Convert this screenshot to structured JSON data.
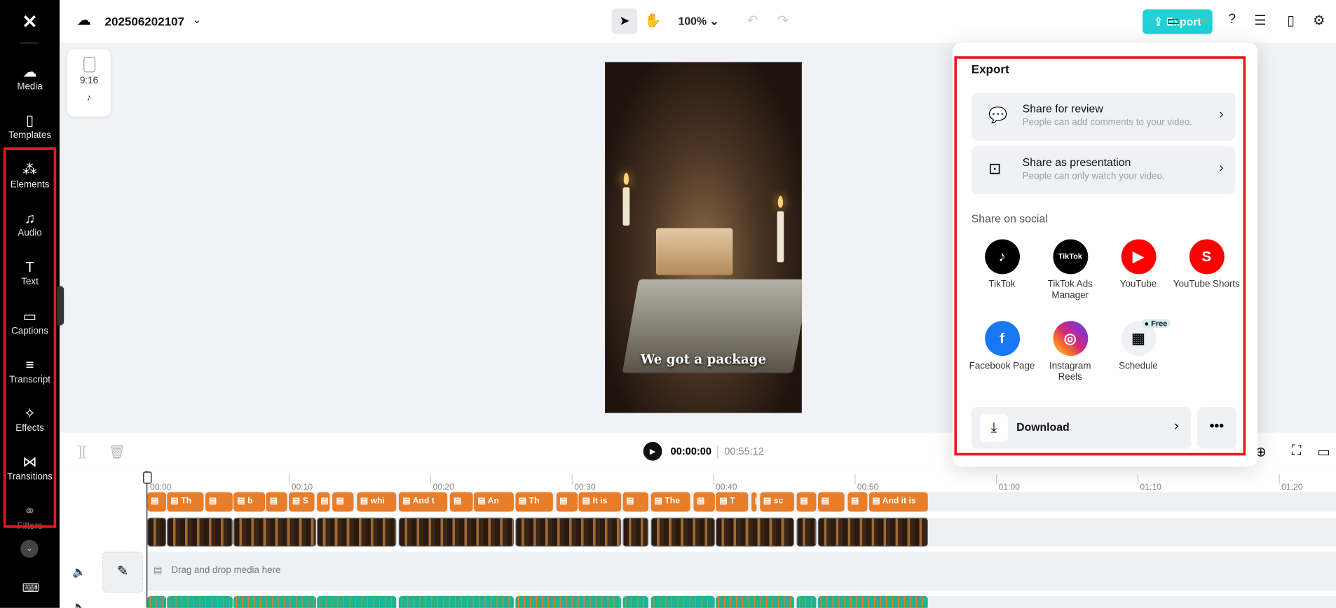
{
  "header": {
    "project_name": "202506202107",
    "zoom": "100%",
    "export_label": "Export"
  },
  "sidebar": {
    "items": [
      {
        "label": "Media",
        "icon": "☁"
      },
      {
        "label": "Templates",
        "icon": "▯"
      },
      {
        "label": "Elements",
        "icon": "⁂"
      },
      {
        "label": "Audio",
        "icon": "♫"
      },
      {
        "label": "Text",
        "icon": "T"
      },
      {
        "label": "Captions",
        "icon": "▭"
      },
      {
        "label": "Transcript",
        "icon": "≡"
      },
      {
        "label": "Effects",
        "icon": "✧"
      },
      {
        "label": "Transitions",
        "icon": "⋈"
      },
      {
        "label": "Filters",
        "icon": "⚭"
      }
    ]
  },
  "canvas": {
    "ratio": "9:16",
    "caption": "We got a package"
  },
  "export_panel": {
    "title": "Export",
    "share_review": {
      "title": "Share for review",
      "subtitle": "People can add comments to your video."
    },
    "share_presentation": {
      "title": "Share as presentation",
      "subtitle": "People can only watch your video."
    },
    "social_heading": "Share on social",
    "socials": [
      {
        "label": "TikTok",
        "color": "#000000",
        "glyph": "♪"
      },
      {
        "label": "TikTok Ads Manager",
        "color": "#000000",
        "glyph": "TikTok"
      },
      {
        "label": "YouTube",
        "color": "#ff0000",
        "glyph": "▶"
      },
      {
        "label": "YouTube Shorts",
        "color": "#ff0000",
        "glyph": "S"
      },
      {
        "label": "Facebook Page",
        "color": "#1877f2",
        "glyph": "f"
      },
      {
        "label": "Instagram Reels",
        "color": "#d62976",
        "glyph": "◎"
      },
      {
        "label": "Schedule",
        "color": "#eff1f4",
        "glyph": "▦"
      }
    ],
    "free_badge": "Free",
    "download_label": "Download"
  },
  "playback": {
    "current": "00:00:00",
    "total": "00:55:12"
  },
  "timeline": {
    "ruler": [
      "00:00",
      "00:10",
      "00:20",
      "00:30",
      "00:40",
      "00:50",
      "01:00",
      "01:10",
      "01:20"
    ],
    "drop_hint": "Drag and drop media here",
    "caption_clips": [
      {
        "s": 0,
        "e": 1.3,
        "t": ""
      },
      {
        "s": 1.4,
        "e": 4,
        "t": "Th"
      },
      {
        "s": 4.1,
        "e": 6,
        "t": ""
      },
      {
        "s": 6.1,
        "e": 8.3,
        "t": "b"
      },
      {
        "s": 8.4,
        "e": 9.9,
        "t": ""
      },
      {
        "s": 10,
        "e": 11.8,
        "t": "S"
      },
      {
        "s": 12,
        "e": 12.9,
        "t": ""
      },
      {
        "s": 13.1,
        "e": 14.6,
        "t": ""
      },
      {
        "s": 14.8,
        "e": 17.6,
        "t": "whi"
      },
      {
        "s": 17.8,
        "e": 21.2,
        "t": "And t"
      },
      {
        "s": 21.4,
        "e": 23,
        "t": ""
      },
      {
        "s": 23.1,
        "e": 25.9,
        "t": "An"
      },
      {
        "s": 26,
        "e": 28.7,
        "t": "Th"
      },
      {
        "s": 28.9,
        "e": 30.4,
        "t": ""
      },
      {
        "s": 30.5,
        "e": 33.5,
        "t": "It is"
      },
      {
        "s": 33.6,
        "e": 35.4,
        "t": ""
      },
      {
        "s": 35.6,
        "e": 38.4,
        "t": "The"
      },
      {
        "s": 38.6,
        "e": 40.1,
        "t": ""
      },
      {
        "s": 40.2,
        "e": 42.5,
        "t": "T"
      },
      {
        "s": 42.7,
        "e": 43.1,
        "t": ""
      },
      {
        "s": 43.3,
        "e": 45.7,
        "t": "sc"
      },
      {
        "s": 45.9,
        "e": 47.3,
        "t": ""
      },
      {
        "s": 47.4,
        "e": 49.3,
        "t": ""
      },
      {
        "s": 49.5,
        "e": 50.9,
        "t": ""
      },
      {
        "s": 51,
        "e": 55.2,
        "t": "And it is"
      }
    ],
    "video_clips": [
      {
        "s": 0,
        "e": 1.3
      },
      {
        "s": 1.4,
        "e": 6
      },
      {
        "s": 6.1,
        "e": 11.9
      },
      {
        "s": 12,
        "e": 17.6
      },
      {
        "s": 17.8,
        "e": 25.9
      },
      {
        "s": 26,
        "e": 33.5
      },
      {
        "s": 33.6,
        "e": 35.4
      },
      {
        "s": 35.6,
        "e": 40.1
      },
      {
        "s": 40.2,
        "e": 45.7
      },
      {
        "s": 45.9,
        "e": 47.3
      },
      {
        "s": 47.4,
        "e": 55.2
      }
    ]
  }
}
